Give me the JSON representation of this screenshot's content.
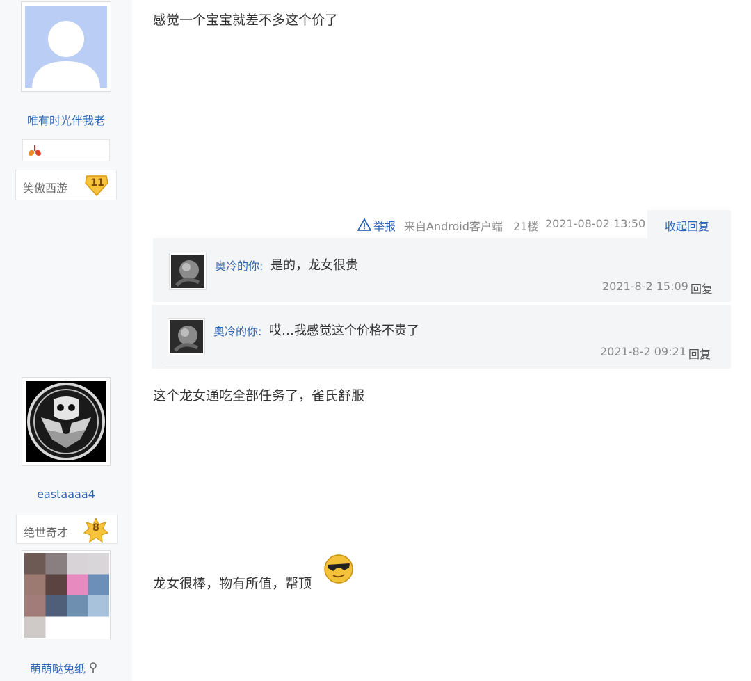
{
  "posts": [
    {
      "username": "唯有时光伴我老",
      "badge_title": "笑傲西游",
      "badge_level": "11",
      "content": "感觉一个宝宝就差不多这个价了",
      "meta": {
        "report": "举报",
        "source": "来自Android客户端",
        "floor": "21楼",
        "time": "2021-08-02 13:50",
        "collapse": "收起回复"
      },
      "replies": [
        {
          "user": "奥冷的你:",
          "text": "是的，龙女很贵",
          "time": "2021-8-2 15:09",
          "reply": "回复"
        },
        {
          "user": "奥冷的你:",
          "text": "哎…我感觉这个价格不贵了",
          "time": "2021-8-2 09:21",
          "reply": "回复"
        }
      ]
    },
    {
      "username": "eastaaaa4",
      "badge_title": "绝世奇才",
      "badge_level": "8",
      "content": "这个龙女通吃全部任务了，雀氏舒服"
    },
    {
      "username": "萌萌哒兔纸",
      "content": "龙女很棒，物有所值，帮顶"
    }
  ],
  "icons": {
    "warning": "warning-icon",
    "lungs": "lungs-icon",
    "gender": "female-icon",
    "emoji": "cool-face-icon"
  },
  "colors": {
    "link": "#2d64b3",
    "reply_bg": "#f4f5f7",
    "left_bg": "#f7f8fa"
  }
}
